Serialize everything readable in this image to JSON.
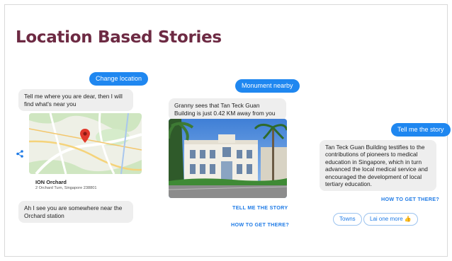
{
  "title": "Location Based Stories",
  "col1": {
    "pill": "Change location",
    "bubble1": "Tell me where you are dear, then I will find what's near you",
    "location_name": "ION Orchard",
    "location_address": "2 Orchard Turn, Singapore 238801",
    "bubble2": "Ah I see you are somewhere near the Orchard station",
    "icons": [
      "share-icon",
      "map-pin-icon"
    ]
  },
  "col2": {
    "pill": "Monument nearby",
    "bubble": "Granny sees that Tan Teck Guan Building is just 0.42 KM away from you",
    "link1": "TELL ME THE STORY",
    "link2": "HOW TO GET THERE?"
  },
  "col3": {
    "pill": "Tell me the story",
    "bubble": "Tan Teck Guan Building testifies to the contributions of pioneers to medical education in Singapore, which in turn advanced the local medical service and encouraged the development of local tertiary education.",
    "link": "HOW TO GET THERE?",
    "chip1": "Towns",
    "chip2": "Lai one more 👍"
  },
  "colors": {
    "title": "#6d2a43",
    "accent": "#1f87f0",
    "bubble": "#eeeeee"
  }
}
